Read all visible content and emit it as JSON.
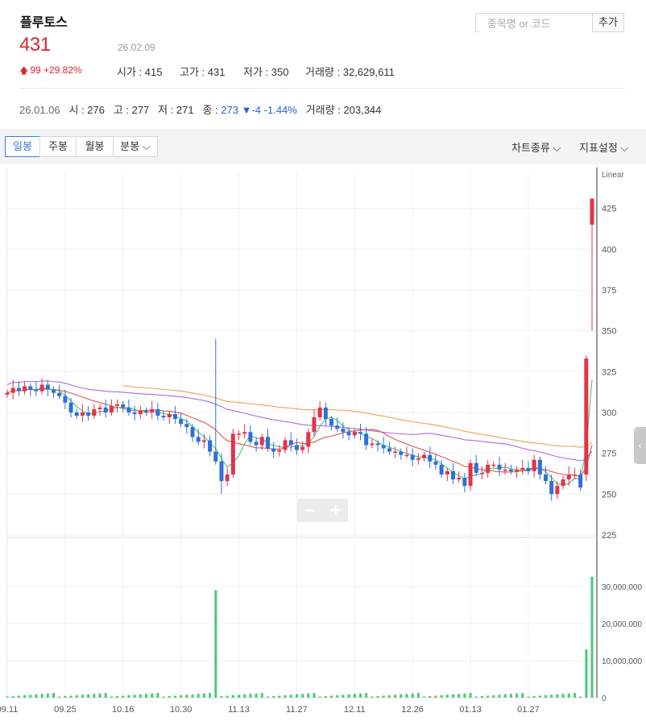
{
  "stock": {
    "name": "플루토스",
    "price": "431",
    "date": "26.02.09",
    "change_arrow": "🡅",
    "change_text": "99 +29.82%",
    "open_label": "시가",
    "open": "415",
    "high_label": "고가",
    "high": "431",
    "low_label": "저가",
    "low": "350",
    "volume_label": "거래량",
    "volume": "32,629,611"
  },
  "search": {
    "placeholder": "종목명 or 코드",
    "add_label": "추가"
  },
  "history": {
    "date": "26.01.06",
    "open": "시 : 276",
    "high": "고 : 277",
    "low": "저 : 271",
    "close_label": "종 : ",
    "close": "273",
    "change": "▼-4 -1.44%",
    "volume": "거래량 : 203,344"
  },
  "toolbar": {
    "tabs": [
      "일봉",
      "주봉",
      "월봉",
      "분봉 ⌵"
    ],
    "chart_type_label": "차트종류 ⌵",
    "indicator_label": "지표설정 ⌵"
  },
  "colors": {
    "up": "#e0344a",
    "down": "#2f6fd8",
    "volume": "#4cc874",
    "ma5": "#4ec27c",
    "ma20": "#e05552",
    "ma60": "#a86ee0",
    "ma120": "#f0a050"
  },
  "zoom": {
    "minus": "−",
    "plus": "+"
  },
  "side_handle": "‹",
  "chart_data": {
    "type": "candlestick",
    "scale_label": "Linear",
    "y_ticks": [
      425,
      400,
      375,
      350,
      325,
      300,
      275,
      250,
      225
    ],
    "ylim": [
      225,
      448
    ],
    "volume_ticks": [
      "30,000,000",
      "20,000,000",
      "10,000,000",
      "0"
    ],
    "volume_lim": [
      0,
      40000000
    ],
    "x_labels": [
      {
        "label": "09.11",
        "i": 0
      },
      {
        "label": "09.25",
        "i": 10
      },
      {
        "label": "10.16",
        "i": 20
      },
      {
        "label": "10.30",
        "i": 30
      },
      {
        "label": "11.13",
        "i": 40
      },
      {
        "label": "11.27",
        "i": 50
      },
      {
        "label": "12.11",
        "i": 60
      },
      {
        "label": "12.26",
        "i": 70
      },
      {
        "label": "01.13",
        "i": 80
      },
      {
        "label": "01.27",
        "i": 90
      }
    ],
    "closes": [
      312,
      315,
      313,
      316,
      314,
      313,
      317,
      314,
      312,
      310,
      306,
      300,
      298,
      300,
      298,
      302,
      303,
      300,
      304,
      305,
      303,
      300,
      299,
      301,
      300,
      302,
      298,
      297,
      299,
      296,
      293,
      291,
      285,
      282,
      283,
      276,
      270,
      258,
      262,
      287,
      287,
      288,
      282,
      280,
      285,
      278,
      276,
      277,
      283,
      280,
      277,
      279,
      288,
      297,
      303,
      296,
      292,
      290,
      288,
      286,
      288,
      287,
      280,
      281,
      280,
      278,
      276,
      276,
      274,
      274,
      271,
      272,
      274,
      270,
      268,
      262,
      264,
      259,
      260,
      255,
      269,
      263,
      263,
      268,
      268,
      265,
      265,
      264,
      265,
      266,
      264,
      271,
      262,
      258,
      250,
      255,
      259,
      262,
      262,
      254,
      333,
      431
    ],
    "volume_spikes": [
      {
        "i": 36,
        "v": 29000000
      },
      {
        "i": 100,
        "v": 13000000
      },
      {
        "i": 101,
        "v": 32629611
      }
    ]
  }
}
